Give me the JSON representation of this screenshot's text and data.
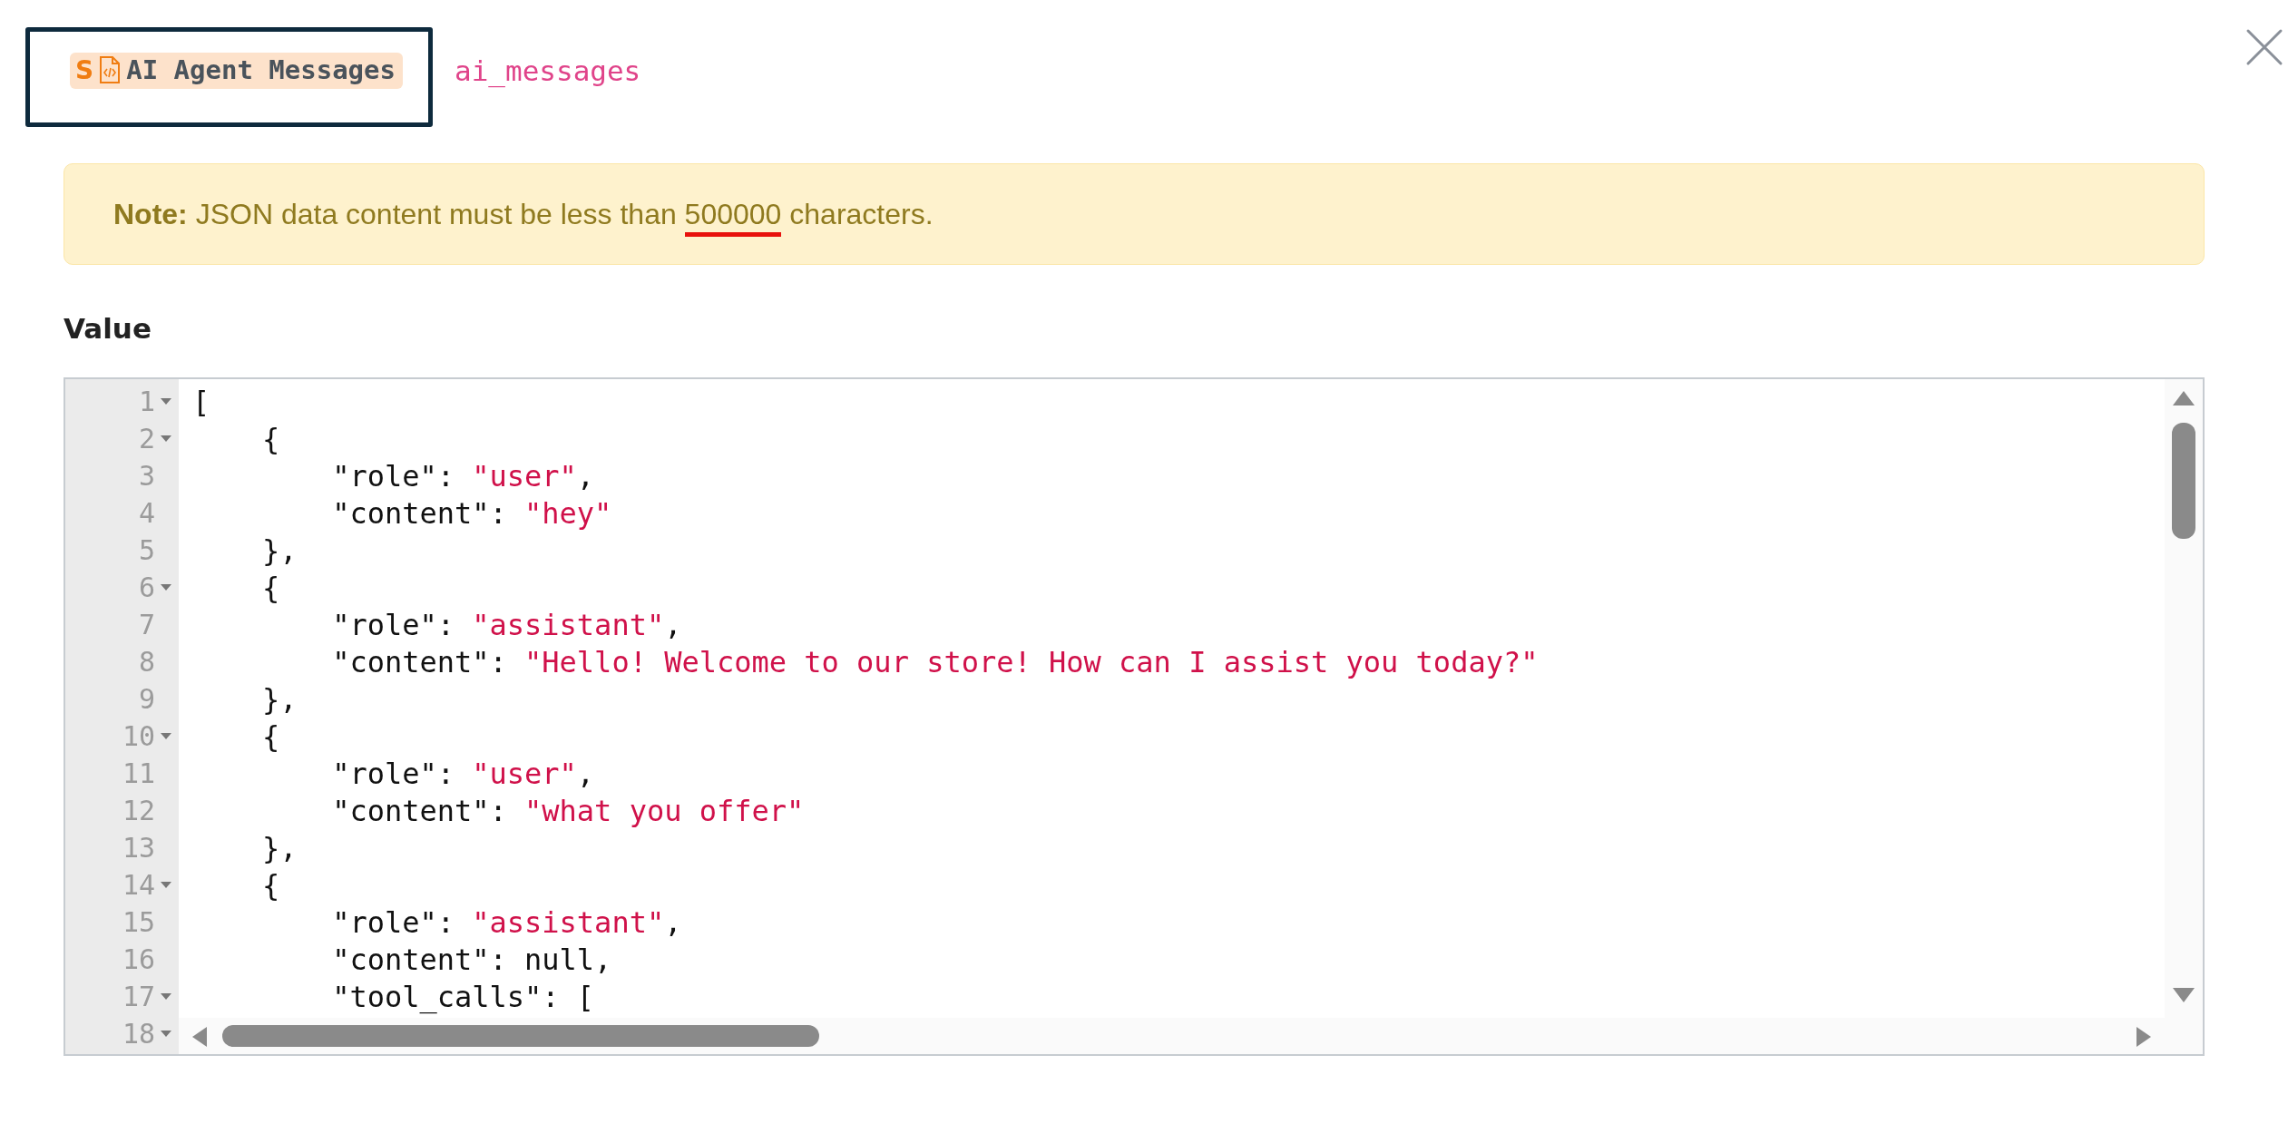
{
  "header": {
    "badge": {
      "letter": "S",
      "title": "AI Agent Messages"
    },
    "key": "ai_messages"
  },
  "note": {
    "label": "Note:",
    "parts": [
      {
        "text": "JSON data content must be less than ",
        "marked": false
      },
      {
        "text": "500000",
        "marked": true
      },
      {
        "text": " characters.",
        "marked": false
      }
    ]
  },
  "field": {
    "label": "Value"
  },
  "editor": {
    "lines": [
      {
        "number": "1",
        "foldable": true,
        "tokens": [
          {
            "kind": "punct",
            "text": "["
          }
        ]
      },
      {
        "number": "2",
        "foldable": true,
        "tokens": [
          {
            "kind": "punct",
            "text": "    {"
          }
        ]
      },
      {
        "number": "3",
        "foldable": false,
        "tokens": [
          {
            "kind": "key",
            "text": "        \"role\": "
          },
          {
            "kind": "string",
            "text": "\"user\""
          },
          {
            "kind": "punct",
            "text": ","
          }
        ]
      },
      {
        "number": "4",
        "foldable": false,
        "tokens": [
          {
            "kind": "key",
            "text": "        \"content\": "
          },
          {
            "kind": "string",
            "text": "\"hey\""
          }
        ]
      },
      {
        "number": "5",
        "foldable": false,
        "tokens": [
          {
            "kind": "punct",
            "text": "    },"
          }
        ]
      },
      {
        "number": "6",
        "foldable": true,
        "tokens": [
          {
            "kind": "punct",
            "text": "    {"
          }
        ]
      },
      {
        "number": "7",
        "foldable": false,
        "tokens": [
          {
            "kind": "key",
            "text": "        \"role\": "
          },
          {
            "kind": "string",
            "text": "\"assistant\""
          },
          {
            "kind": "punct",
            "text": ","
          }
        ]
      },
      {
        "number": "8",
        "foldable": false,
        "tokens": [
          {
            "kind": "key",
            "text": "        \"content\": "
          },
          {
            "kind": "string",
            "text": "\"Hello! Welcome to our store! How can I assist you today?\""
          }
        ]
      },
      {
        "number": "9",
        "foldable": false,
        "tokens": [
          {
            "kind": "punct",
            "text": "    },"
          }
        ]
      },
      {
        "number": "10",
        "foldable": true,
        "tokens": [
          {
            "kind": "punct",
            "text": "    {"
          }
        ]
      },
      {
        "number": "11",
        "foldable": false,
        "tokens": [
          {
            "kind": "key",
            "text": "        \"role\": "
          },
          {
            "kind": "string",
            "text": "\"user\""
          },
          {
            "kind": "punct",
            "text": ","
          }
        ]
      },
      {
        "number": "12",
        "foldable": false,
        "tokens": [
          {
            "kind": "key",
            "text": "        \"content\": "
          },
          {
            "kind": "string",
            "text": "\"what you offer\""
          }
        ]
      },
      {
        "number": "13",
        "foldable": false,
        "tokens": [
          {
            "kind": "punct",
            "text": "    },"
          }
        ]
      },
      {
        "number": "14",
        "foldable": true,
        "tokens": [
          {
            "kind": "punct",
            "text": "    {"
          }
        ]
      },
      {
        "number": "15",
        "foldable": false,
        "tokens": [
          {
            "kind": "key",
            "text": "        \"role\": "
          },
          {
            "kind": "string",
            "text": "\"assistant\""
          },
          {
            "kind": "punct",
            "text": ","
          }
        ]
      },
      {
        "number": "16",
        "foldable": false,
        "tokens": [
          {
            "kind": "key",
            "text": "        \"content\": null,"
          }
        ]
      },
      {
        "number": "17",
        "foldable": true,
        "tokens": [
          {
            "kind": "key",
            "text": "        \"tool_calls\": ["
          }
        ]
      },
      {
        "number": "18",
        "foldable": true
      }
    ]
  }
}
